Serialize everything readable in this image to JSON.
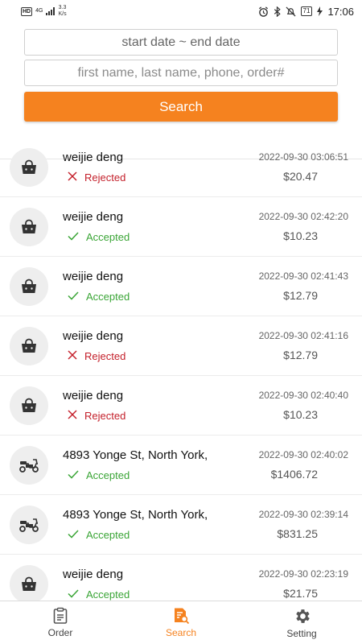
{
  "status_bar": {
    "hd": "HD",
    "network": "4G",
    "speed_value": "3.3",
    "speed_unit": "K/s",
    "battery": "71",
    "time": "17:06"
  },
  "search": {
    "date_placeholder": "start date ~ end date",
    "query_placeholder": "first name, last name, phone, order#",
    "button_label": "Search",
    "accent_color": "#f5821f"
  },
  "orders": [
    {
      "icon": "basket-icon",
      "name": "weijie deng",
      "status": "Rejected",
      "state": "rejected",
      "time": "2022-09-30 03:06:51",
      "amount": "$20.47"
    },
    {
      "icon": "basket-icon",
      "name": "weijie deng",
      "status": "Accepted",
      "state": "accepted",
      "time": "2022-09-30 02:42:20",
      "amount": "$10.23"
    },
    {
      "icon": "basket-icon",
      "name": "weijie deng",
      "status": "Accepted",
      "state": "accepted",
      "time": "2022-09-30 02:41:43",
      "amount": "$12.79"
    },
    {
      "icon": "basket-icon",
      "name": "weijie deng",
      "status": "Rejected",
      "state": "rejected",
      "time": "2022-09-30 02:41:16",
      "amount": "$12.79"
    },
    {
      "icon": "basket-icon",
      "name": "weijie deng",
      "status": "Rejected",
      "state": "rejected",
      "time": "2022-09-30 02:40:40",
      "amount": "$10.23"
    },
    {
      "icon": "scooter-icon",
      "name": "4893 Yonge St, North York,",
      "status": "Accepted",
      "state": "accepted",
      "time": "2022-09-30 02:40:02",
      "amount": "$1406.72"
    },
    {
      "icon": "scooter-icon",
      "name": "4893 Yonge St, North York,",
      "status": "Accepted",
      "state": "accepted",
      "time": "2022-09-30 02:39:14",
      "amount": "$831.25"
    },
    {
      "icon": "basket-icon",
      "name": "weijie deng",
      "status": "Accepted",
      "state": "accepted",
      "time": "2022-09-30 02:23:19",
      "amount": "$21.75"
    }
  ],
  "tabs": [
    {
      "label": "Order",
      "icon": "clipboard-icon",
      "active": false
    },
    {
      "label": "Search",
      "icon": "document-search-icon",
      "active": true
    },
    {
      "label": "Setting",
      "icon": "gear-icon",
      "active": false
    }
  ]
}
